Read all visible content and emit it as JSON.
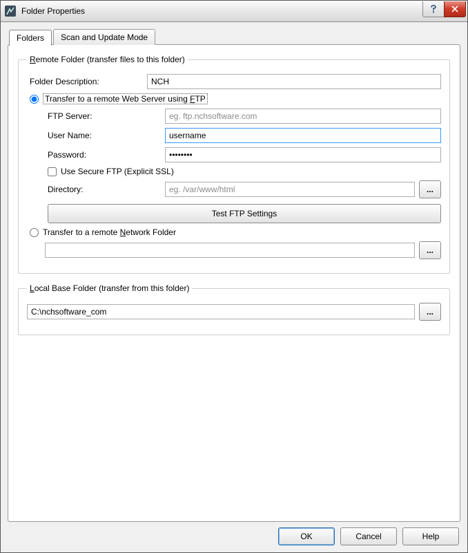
{
  "window": {
    "title": "Folder Properties"
  },
  "tabs": {
    "folders": "Folders",
    "scan": "Scan and Update Mode"
  },
  "remote": {
    "legend_prefix": "R",
    "legend_rest": "emote Folder (transfer files to this folder)",
    "desc_label": "Folder Description:",
    "desc_value": "NCH",
    "radio_ftp": "Transfer to a remote Web Server using ",
    "radio_ftp_u": "F",
    "radio_ftp_rest": "TP",
    "ftp_server_label": "FTP Server:",
    "ftp_server_placeholder": "eg. ftp.nchsoftware.com",
    "user_label": "User Name:",
    "user_value": "username",
    "pass_label": "Password:",
    "pass_value": "password",
    "secure_label": "Use Secure FTP (Explicit SSL)",
    "dir_label": "Directory:",
    "dir_placeholder": "eg. /var/www/html",
    "test_btn": "Test FTP Settings",
    "radio_net": "Transfer to a remote ",
    "radio_net_u": "N",
    "radio_net_rest": "etwork Folder",
    "net_path": ""
  },
  "local": {
    "legend_u": "L",
    "legend_rest": "ocal Base Folder (transfer from this folder)",
    "path": "C:\\nchsoftware_com"
  },
  "buttons": {
    "ok": "OK",
    "cancel": "Cancel",
    "help": "Help",
    "browse": "..."
  }
}
